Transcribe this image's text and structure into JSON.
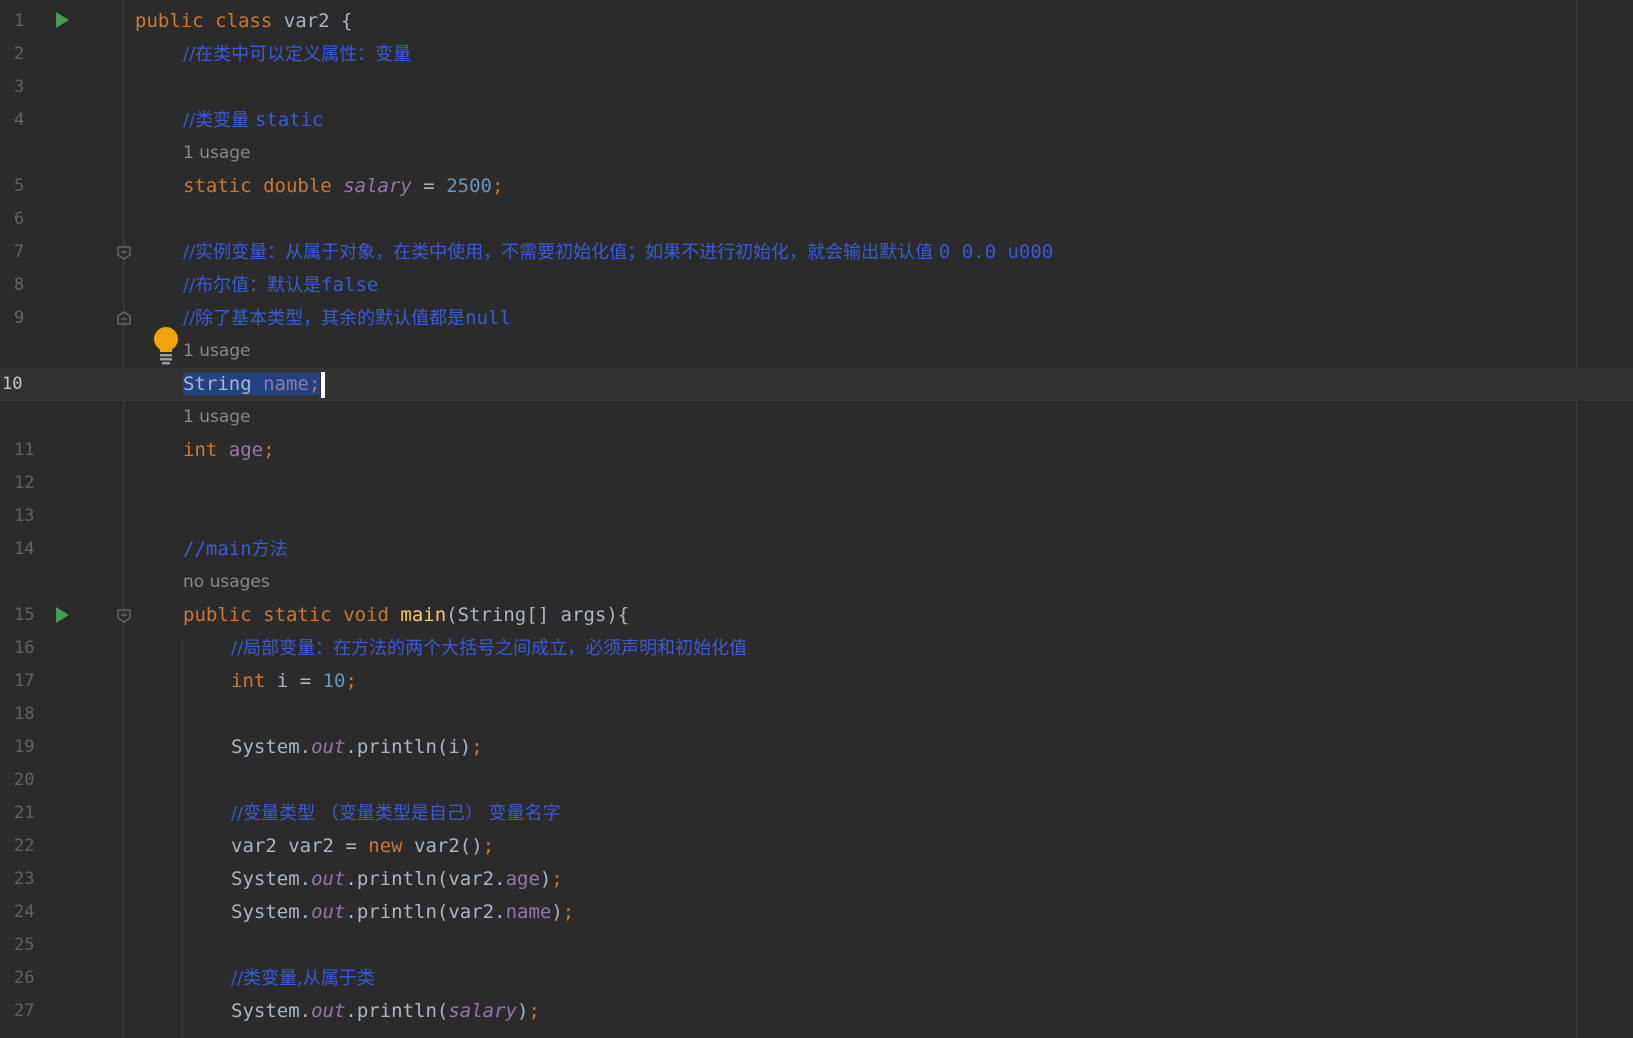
{
  "editor": {
    "caret_line": "10",
    "lines": [
      {
        "n": "1"
      },
      {
        "n": "2"
      },
      {
        "n": "3"
      },
      {
        "n": "4"
      },
      {
        "n": "5"
      },
      {
        "n": "6"
      },
      {
        "n": "7"
      },
      {
        "n": "8"
      },
      {
        "n": "9"
      },
      {
        "n": "10"
      },
      {
        "n": "11"
      },
      {
        "n": "12"
      },
      {
        "n": "13"
      },
      {
        "n": "14"
      },
      {
        "n": "15"
      },
      {
        "n": "16"
      },
      {
        "n": "17"
      },
      {
        "n": "18"
      },
      {
        "n": "19"
      },
      {
        "n": "20"
      },
      {
        "n": "21"
      },
      {
        "n": "22"
      },
      {
        "n": "23"
      },
      {
        "n": "24"
      },
      {
        "n": "25"
      },
      {
        "n": "26"
      },
      {
        "n": "27"
      }
    ],
    "hints": {
      "salary_usage": "1 usage",
      "name_usage": "1 usage",
      "age_usage": "1 usage",
      "main_usage": "no usages"
    },
    "code": {
      "l1": {
        "public": "public",
        "class": "class",
        "name": "var2",
        "brace": "{"
      },
      "l2": {
        "comment": "//在类中可以定义属性：变量"
      },
      "l4": {
        "comment_a": "//类变量 ",
        "comment_b": "static"
      },
      "l5": {
        "static": "static",
        "double": "double",
        "field": "salary",
        "eq": "=",
        "value": "2500",
        "semi": ";"
      },
      "l7": {
        "comment_a": "//实例变量：从属于对象，在类中使用，不需要初始化值；如果不进行初始化，就会输出默认值 ",
        "comment_b": "0 0.0 u000"
      },
      "l8": {
        "comment_a": "//布尔值：默认是",
        "comment_b": "false"
      },
      "l9": {
        "comment_a": "//除了基本类型，其余的默认值都是",
        "comment_b": "null"
      },
      "l10": {
        "type": "String",
        "field": "name",
        "semi": ";"
      },
      "l11": {
        "type": "int",
        "field": "age",
        "semi": ";"
      },
      "l14": {
        "comment_a": "//main",
        "comment_b": "方法"
      },
      "l15": {
        "public": "public",
        "static": "static",
        "void": "void",
        "method": "main",
        "params": "(String[] args){"
      },
      "l16": {
        "comment": "//局部变量：在方法的两个大括号之间成立，必须声明和初始化值"
      },
      "l17": {
        "type": "int",
        "var": "i",
        "eq": "=",
        "value": "10",
        "semi": ";"
      },
      "l19": {
        "sys": "System.",
        "out": "out",
        "call": ".println(i)",
        "semi": ";"
      },
      "l21": {
        "comment": "//变量类型 （变量类型是自己） 变量名字"
      },
      "l22": {
        "decl": "var2 var2 = ",
        "new": "new",
        "ctor": " var2()",
        "semi": ";"
      },
      "l23": {
        "sys": "System.",
        "out": "out",
        "call_a": ".println(var2.",
        "field": "age",
        "call_b": ")",
        "semi": ";"
      },
      "l24": {
        "sys": "System.",
        "out": "out",
        "call_a": ".println(var2.",
        "field": "name",
        "call_b": ")",
        "semi": ";"
      },
      "l26": {
        "comment": "//类变量,从属于类"
      },
      "l27": {
        "sys": "System.",
        "out": "out",
        "call_a": ".println(",
        "field": "salary",
        "call_b": ")",
        "semi": ";"
      }
    },
    "icons": {
      "run": "run-icon",
      "fold": "fold-icon",
      "bulb": "intention-bulb-icon"
    },
    "colors": {
      "background": "#2b2b2b",
      "keyword": "#cc7832",
      "comment": "#3b5bd6",
      "number": "#6897bb",
      "field": "#9876aa",
      "method": "#ffc66d",
      "selection": "#214283"
    }
  }
}
